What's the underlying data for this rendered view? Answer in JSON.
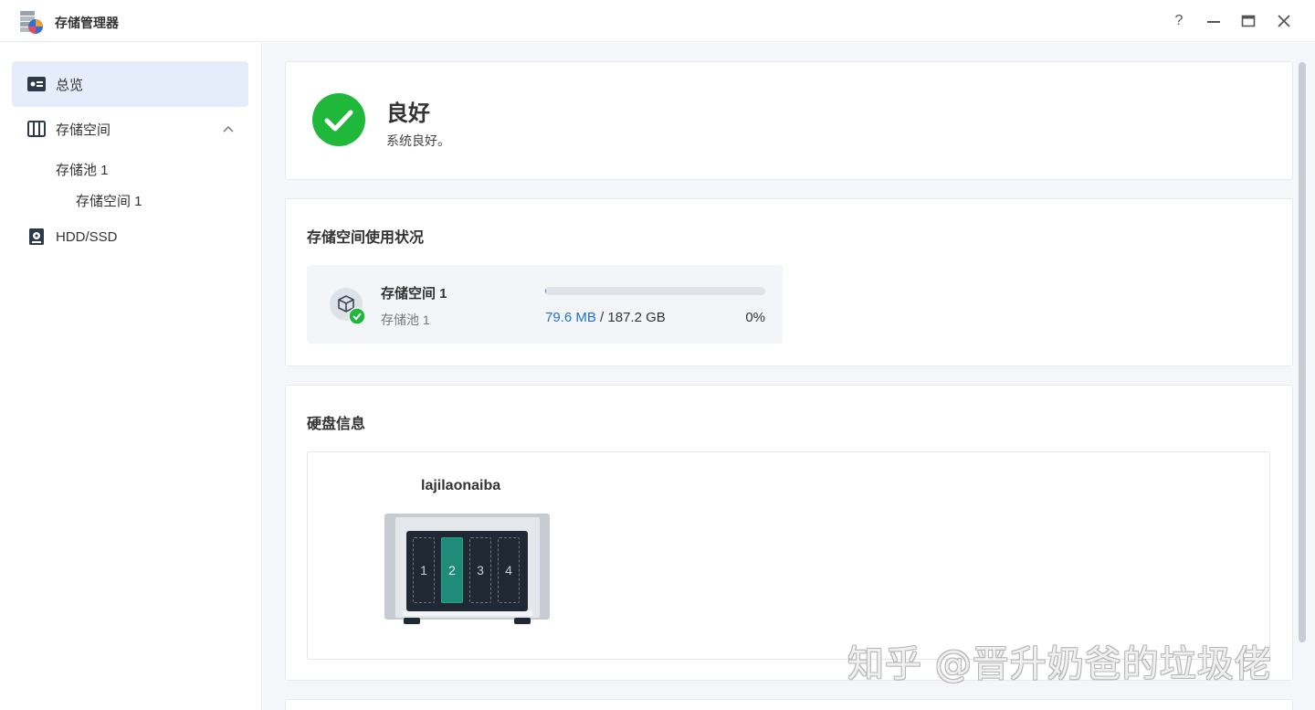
{
  "window": {
    "title": "存储管理器",
    "controls": {
      "help": "?",
      "minimize": "—",
      "maximize": "▭",
      "close": "✕"
    }
  },
  "sidebar": {
    "items": [
      {
        "label": "总览",
        "icon": "overview-icon",
        "active": true
      },
      {
        "label": "存储空间",
        "icon": "storage-icon",
        "expanded": true
      },
      {
        "label": "存储池 1"
      },
      {
        "label": "存储空间 1"
      },
      {
        "label": "HDD/SSD",
        "icon": "hdd-icon"
      }
    ]
  },
  "status": {
    "title": "良好",
    "subtitle": "系统良好。",
    "color": "#1fb83b"
  },
  "usage": {
    "title": "存储空间使用状况",
    "volume": {
      "name": "存储空间 1",
      "pool": "存储池 1",
      "used": "79.6 MB",
      "separator": " / ",
      "total": "187.2 GB",
      "percent": "0%",
      "fill_fraction": 0.0004
    }
  },
  "disks": {
    "title": "硬盘信息",
    "nas_name": "lajilaonaiba",
    "bays": [
      {
        "label": "1",
        "installed": false
      },
      {
        "label": "2",
        "installed": true
      },
      {
        "label": "3",
        "installed": false
      },
      {
        "label": "4",
        "installed": false
      }
    ],
    "installed_color": "#1e8c78"
  },
  "watermark": "知乎 @晋升奶爸的垃圾佬"
}
